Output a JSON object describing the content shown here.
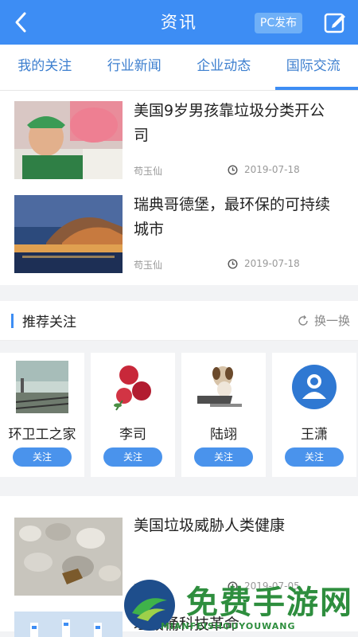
{
  "header": {
    "title": "资讯",
    "pc_button": "PC发布"
  },
  "tabs": [
    {
      "label": "我的关注"
    },
    {
      "label": "行业新闻"
    },
    {
      "label": "企业动态"
    },
    {
      "label": "国际交流"
    }
  ],
  "news": [
    {
      "title": "美国9岁男孩靠垃圾分类开公司",
      "author": "苟玉仙",
      "date": "2019-07-18",
      "thumb": "child-with-recycling-bags"
    },
    {
      "title": "瑞典哥德堡，最环保的可持续城市",
      "author": "苟玉仙",
      "date": "2019-07-18",
      "thumb": "gothenburg-night-harbor"
    }
  ],
  "recommend": {
    "title": "推荐关注",
    "refresh_label": "换一换",
    "follow_label": "关注",
    "cards": [
      {
        "name": "环卫工之家",
        "img": "railway-scene"
      },
      {
        "name": "李司",
        "img": "red-roses"
      },
      {
        "name": "陆翊",
        "img": "dog-on-laptop"
      },
      {
        "name": "王潇",
        "img": "default-avatar-icon"
      }
    ]
  },
  "news2": [
    {
      "title": "美国垃圾威胁人类健康",
      "author": "苟玉仙",
      "date": "2019-07-05",
      "thumb": "plastic-bottle-pile"
    },
    {
      "title": "垃圾桶科技革命",
      "thumb": "street-bins"
    }
  ],
  "watermark": {
    "text": "免费手游网",
    "sub": "MIANFEISHOUYOUWANG"
  },
  "colors": {
    "accent": "#3d8df4",
    "tab_text": "#3d7fcf",
    "follow_btn": "#4a93ec"
  }
}
